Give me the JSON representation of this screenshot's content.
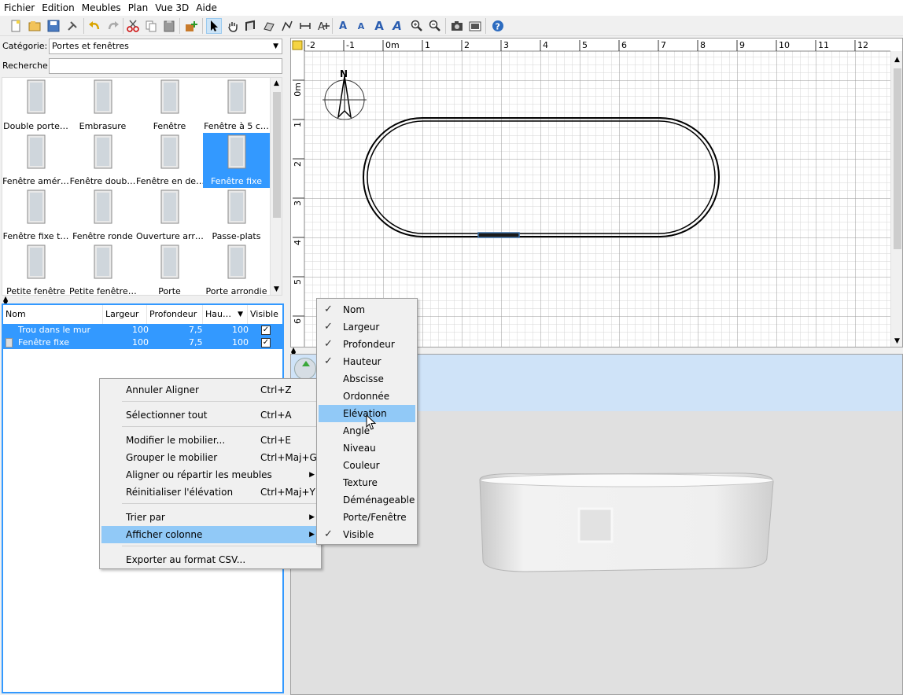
{
  "menubar": {
    "items": [
      "Fichier",
      "Edition",
      "Meubles",
      "Plan",
      "Vue 3D",
      "Aide"
    ]
  },
  "catalog": {
    "category_label": "Catégorie:",
    "category_value": "Portes et fenêtres",
    "search_label": "Recherche:",
    "search_value": "",
    "items": [
      "Double porte…",
      "Embrasure",
      "Fenêtre",
      "Fenêtre à 5 c…",
      "Fenêtre amér…",
      "Fenêtre doub…",
      "Fenêtre en de…",
      "Fenêtre fixe",
      "Fenêtre fixe t…",
      "Fenêtre ronde",
      "Ouverture arr…",
      "Passe-plats",
      "Petite fenêtre",
      "Petite fenêtre…",
      "Porte",
      "Porte arrondie"
    ],
    "selected_index": 7
  },
  "furniture_table": {
    "columns": [
      "Nom",
      "Largeur",
      "Profondeur",
      "Hau…",
      "Visible"
    ],
    "sort_indicator": "▼",
    "rows": [
      {
        "name": "Trou dans le mur",
        "width": "100",
        "depth": "7,5",
        "height": "100",
        "visible": true
      },
      {
        "name": "Fenêtre fixe",
        "width": "100",
        "depth": "7,5",
        "height": "100",
        "visible": true
      }
    ]
  },
  "plan": {
    "ruler_x": [
      "-2",
      "-1",
      "0m",
      "1",
      "2",
      "3",
      "4",
      "5",
      "6",
      "7",
      "8",
      "9",
      "10",
      "11",
      "12"
    ],
    "ruler_y": [
      "0m",
      "1",
      "2",
      "3",
      "4",
      "5",
      "6"
    ],
    "compass_label": "N"
  },
  "context_menu": {
    "items": [
      {
        "label": "Annuler Aligner",
        "shortcut": "Ctrl+Z"
      },
      {
        "label": "Sélectionner tout",
        "shortcut": "Ctrl+A"
      },
      {
        "label": "Modifier le mobilier...",
        "shortcut": "Ctrl+E"
      },
      {
        "label": "Grouper le mobilier",
        "shortcut": "Ctrl+Maj+G"
      },
      {
        "label": "Aligner ou répartir les meubles",
        "shortcut": ""
      },
      {
        "label": "Réinitialiser l'élévation",
        "shortcut": "Ctrl+Maj+Y"
      },
      {
        "label": "Trier par",
        "shortcut": ""
      },
      {
        "label": "Afficher colonne",
        "shortcut": ""
      },
      {
        "label": "Exporter au format CSV...",
        "shortcut": ""
      }
    ]
  },
  "column_submenu": {
    "items": [
      {
        "label": "Nom",
        "checked": true
      },
      {
        "label": "Largeur",
        "checked": true
      },
      {
        "label": "Profondeur",
        "checked": true
      },
      {
        "label": "Hauteur",
        "checked": true
      },
      {
        "label": "Abscisse",
        "checked": false
      },
      {
        "label": "Ordonnée",
        "checked": false
      },
      {
        "label": "Elévation",
        "checked": false
      },
      {
        "label": "Angle",
        "checked": false
      },
      {
        "label": "Niveau",
        "checked": false
      },
      {
        "label": "Couleur",
        "checked": false
      },
      {
        "label": "Texture",
        "checked": false
      },
      {
        "label": "Déménageable",
        "checked": false
      },
      {
        "label": "Porte/Fenêtre",
        "checked": false
      },
      {
        "label": "Visible",
        "checked": true
      }
    ],
    "highlighted_index": 6
  },
  "colors": {
    "selection": "#3399ff",
    "menu_highlight": "#91c9f7",
    "wall": "#000000",
    "window_in_plan": "#1a1a1a"
  }
}
